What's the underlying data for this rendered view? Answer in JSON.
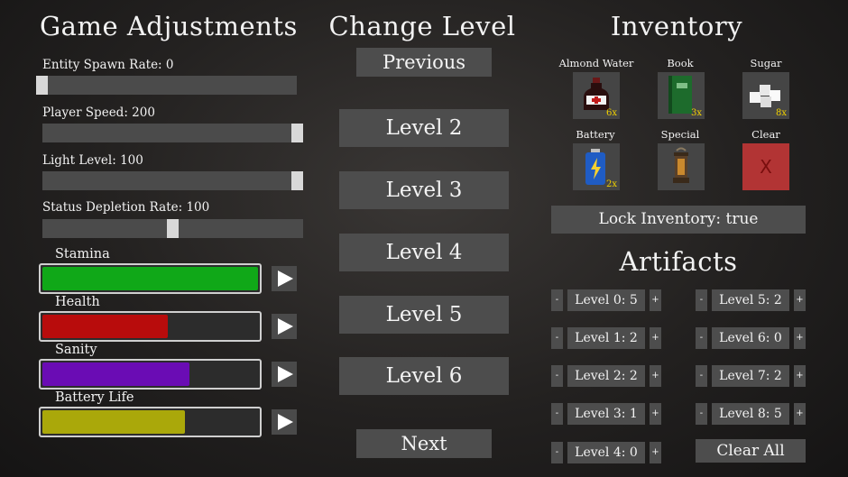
{
  "adjustments": {
    "title": "Game Adjustments",
    "sliders": [
      {
        "label": "Entity Spawn Rate: 0",
        "fraction": 0.0
      },
      {
        "label": "Player Speed: 200",
        "fraction": 1.0
      },
      {
        "label": "Light Level: 100",
        "fraction": 1.0
      },
      {
        "label": "Status Depletion Rate: 100",
        "fraction": 0.5
      }
    ],
    "stats": [
      {
        "label": "Stamina",
        "percent": 100,
        "color": "#10a818"
      },
      {
        "label": "Health",
        "percent": 58,
        "color": "#b80c0c"
      },
      {
        "label": "Sanity",
        "percent": 68,
        "color": "#6a0cb4"
      },
      {
        "label": "Battery Life",
        "percent": 66,
        "color": "#aaa80a"
      }
    ]
  },
  "levels": {
    "title": "Change Level",
    "previous": "Previous",
    "next": "Next",
    "buttons": [
      "Level 2",
      "Level 3",
      "Level 4",
      "Level 5",
      "Level 6"
    ]
  },
  "inventory": {
    "title": "Inventory",
    "items": [
      {
        "name": "Almond Water",
        "count": "6x",
        "icon": "almond-water-bottle-icon"
      },
      {
        "name": "Book",
        "count": "3x",
        "icon": "green-book-icon"
      },
      {
        "name": "Sugar",
        "count": "8x",
        "icon": "sugar-cubes-icon"
      },
      {
        "name": "Battery",
        "count": "2x",
        "icon": "battery-icon"
      },
      {
        "name": "Special",
        "count": "",
        "icon": "lantern-icon"
      },
      {
        "name": "Clear",
        "count": "",
        "icon": "clear-x-icon",
        "mark": "X"
      }
    ],
    "lock": "Lock Inventory: true"
  },
  "artifacts": {
    "title": "Artifacts",
    "minus": "-",
    "plus": "+",
    "entries": [
      "Level 0: 5",
      "Level 1: 2",
      "Level 2: 2",
      "Level 3: 1",
      "Level 4: 0",
      "Level 5: 2",
      "Level 6: 0",
      "Level 7: 2",
      "Level 8: 5"
    ],
    "clear_all": "Clear All"
  },
  "colors": {
    "button": "#4d4d4d",
    "count": "#f0d000",
    "clear_slot": "#b23434"
  }
}
